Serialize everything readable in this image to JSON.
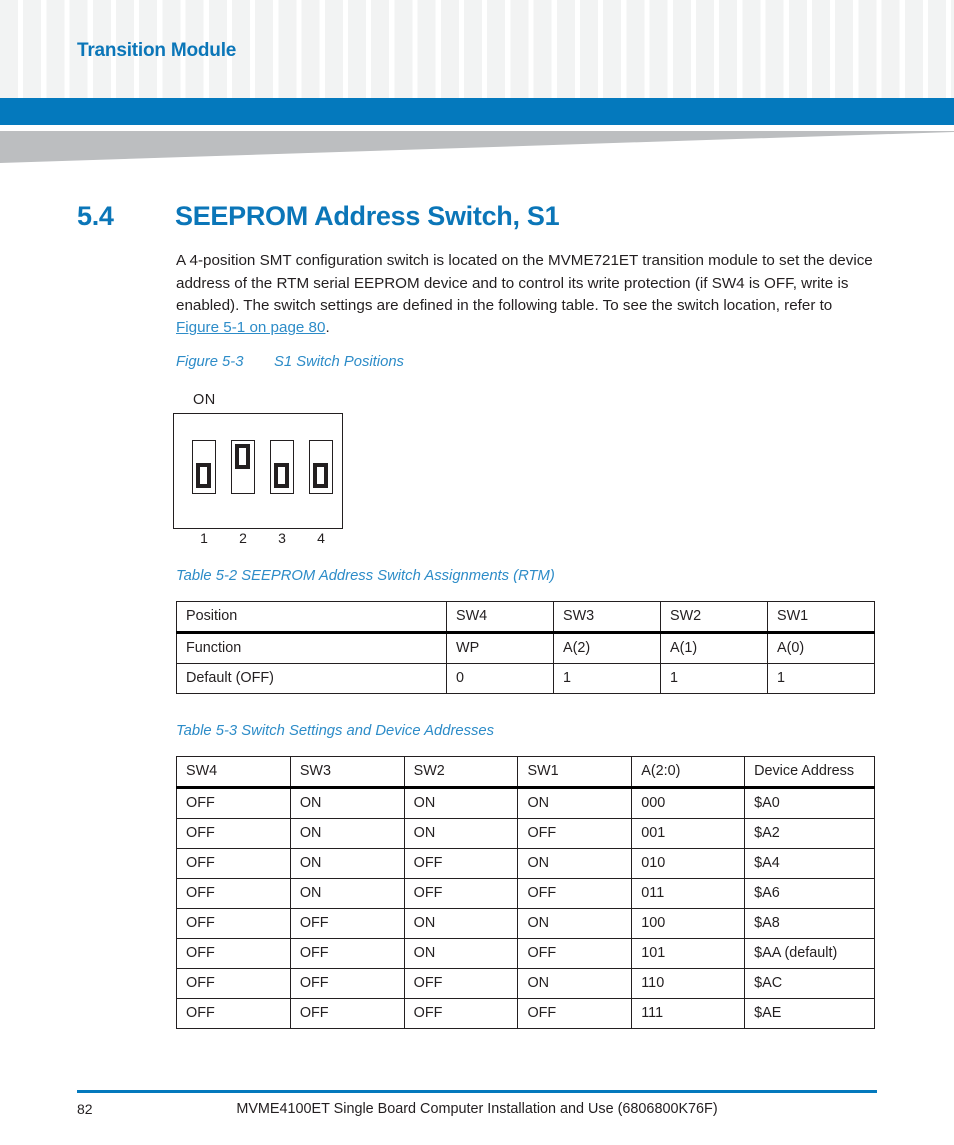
{
  "header": {
    "running_title": "Transition Module",
    "accent_blue": "#0479bd",
    "title_blue": "#0b76b8",
    "wedge_gray": "#bcbec0"
  },
  "section": {
    "number": "5.4",
    "title": "SEEPROM Address Switch, S1",
    "paragraph_before_link": "A 4-position SMT configuration switch is located on the MVME721ET transition module to set the device address of the RTM serial EEPROM device and to control its write protection (if SW4 is OFF, write is enabled). The switch settings are defined in the following table. To see the switch location, refer to ",
    "link_text": "Figure 5-1 on page 80",
    "paragraph_after_link": "."
  },
  "figure": {
    "number": "Figure 5-3",
    "title": "S1 Switch Positions",
    "on_label": "ON",
    "switch_labels": [
      "1",
      "2",
      "3",
      "4"
    ],
    "switch_states": [
      "OFF",
      "ON",
      "OFF",
      "OFF"
    ]
  },
  "table_5_2": {
    "caption": "Table 5-2 SEEPROM Address Switch Assignments (RTM)",
    "headers": [
      "Position",
      "SW4",
      "SW3",
      "SW2",
      "SW1"
    ],
    "rows": [
      [
        "Function",
        "WP",
        "A(2)",
        "A(1)",
        "A(0)"
      ],
      [
        "Default (OFF)",
        "0",
        "1",
        "1",
        "1"
      ]
    ]
  },
  "table_5_3": {
    "caption": "Table 5-3 Switch Settings and Device Addresses",
    "headers": [
      "SW4",
      "SW3",
      "SW2",
      "SW1",
      "A(2:0)",
      "Device Address"
    ],
    "rows": [
      [
        "OFF",
        "ON",
        "ON",
        "ON",
        "000",
        "$A0"
      ],
      [
        "OFF",
        "ON",
        "ON",
        "OFF",
        "001",
        "$A2"
      ],
      [
        "OFF",
        "ON",
        "OFF",
        "ON",
        "010",
        "$A4"
      ],
      [
        "OFF",
        "ON",
        "OFF",
        "OFF",
        "011",
        "$A6"
      ],
      [
        "OFF",
        "OFF",
        "ON",
        "ON",
        "100",
        "$A8"
      ],
      [
        "OFF",
        "OFF",
        "ON",
        "OFF",
        "101",
        "$AA (default)"
      ],
      [
        "OFF",
        "OFF",
        "OFF",
        "ON",
        "110",
        "$AC"
      ],
      [
        "OFF",
        "OFF",
        "OFF",
        "OFF",
        "111",
        "$AE"
      ]
    ]
  },
  "footer": {
    "page_number": "82",
    "document_title": "MVME4100ET Single Board Computer Installation and Use (6806800K76F)"
  }
}
